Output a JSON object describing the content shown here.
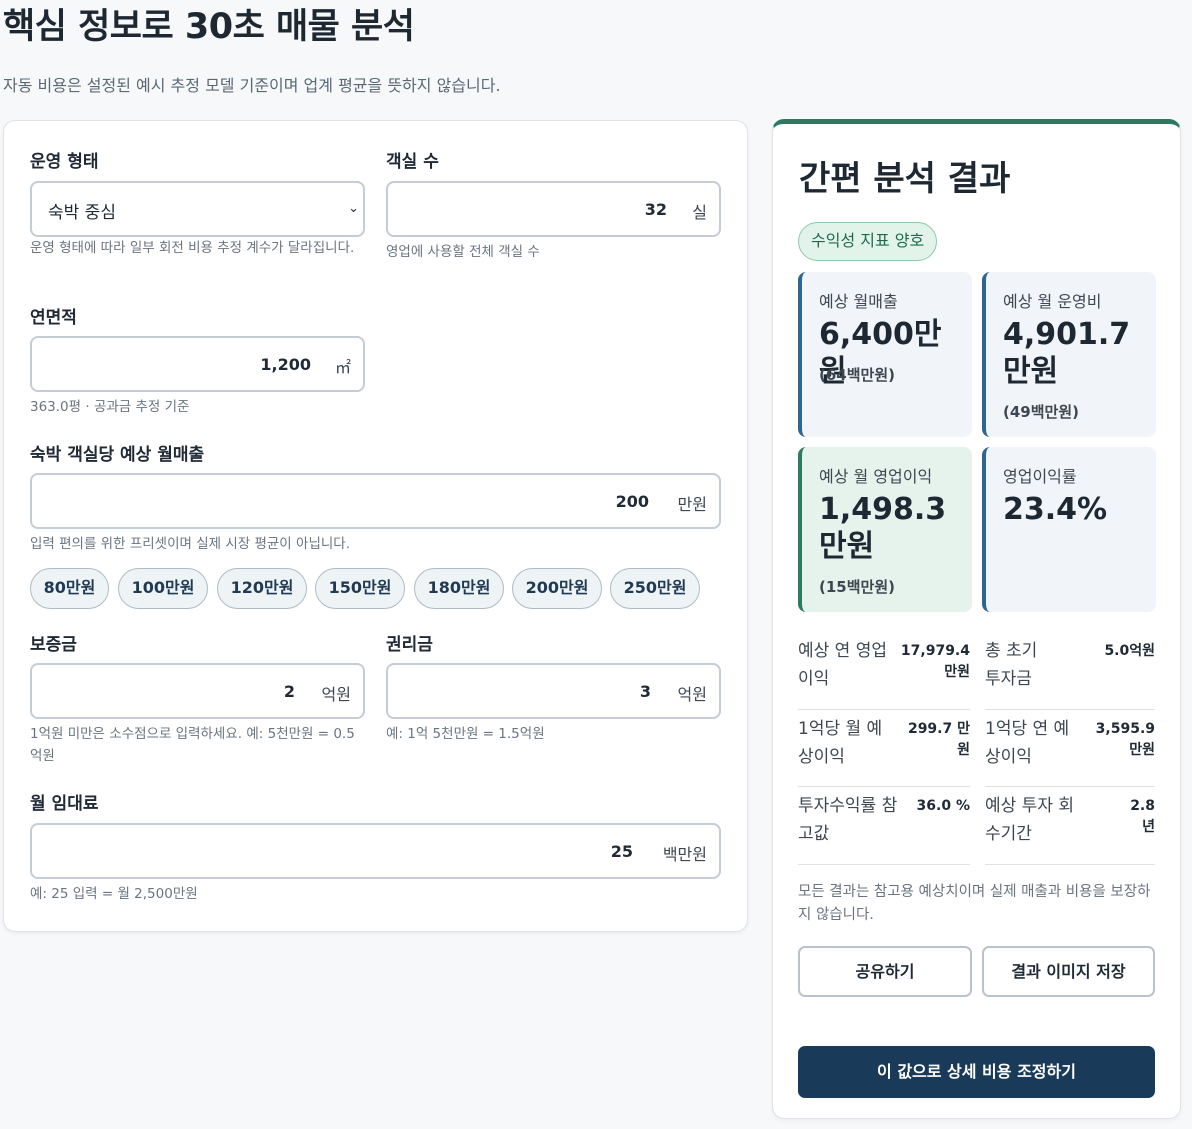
{
  "header": {
    "title": "핵심 정보로 30초 매물 분석",
    "subtitle": "자동 비용은 설정된 예시 추정 모델 기준이며 업계 평균을 뜻하지 않습니다."
  },
  "form": {
    "operation_type": {
      "label": "운영 형태",
      "value": "숙박 중심",
      "hint": "운영 형태에 따라 일부 회전 비용 추정 계수가 달라집니다."
    },
    "rooms": {
      "label": "객실 수",
      "value": "32",
      "unit": "실",
      "hint": "영업에 사용할 전체 객실 수"
    },
    "floor_area": {
      "label": "연면적",
      "value": "1,200",
      "unit": "㎡",
      "hint": "363.0평 · 공과금 추정 기준"
    },
    "revenue_per_room": {
      "label": "숙박 객실당 예상 월매출",
      "value": "200",
      "unit": "만원",
      "hint": "입력 편의를 위한 프리셋이며 실제 시장 평균이 아닙니다.",
      "presets": [
        "80만원",
        "100만원",
        "120만원",
        "150만원",
        "180만원",
        "200만원",
        "250만원"
      ]
    },
    "deposit": {
      "label": "보증금",
      "value": "2",
      "unit": "억원",
      "hint": "1억원 미만은 소수점으로 입력하세요. 예: 5천만원 = 0.5억원"
    },
    "premium": {
      "label": "권리금",
      "value": "3",
      "unit": "억원",
      "hint": "예: 1억 5천만원 = 1.5억원"
    },
    "monthly_rent": {
      "label": "월 임대료",
      "value": "25",
      "unit": "백만원",
      "hint": "예: 25 입력 = 월 2,500만원"
    }
  },
  "result": {
    "title": "간편 분석 결과",
    "badge": "수익성 지표 양호",
    "metrics": [
      {
        "label": "예상 월매출",
        "value": "6,400만원",
        "sub": "(64백만원)"
      },
      {
        "label": "예상 월 운영비",
        "value": "4,901.7만원",
        "sub": "(49백만원)"
      },
      {
        "label": "예상 월 영업이익",
        "value": "1,498.3만원",
        "sub": "(15백만원)"
      },
      {
        "label": "영업이익률",
        "value": "23.4%",
        "sub": ""
      }
    ],
    "stats": [
      {
        "label": "예상 연 영업이익",
        "value": "17,979.4 만원"
      },
      {
        "label": "총 초기 투자금",
        "value": "5.0억원"
      },
      {
        "label": "1억당 월 예상이익",
        "value": "299.7 만원"
      },
      {
        "label": "1억당 연 예상이익",
        "value": "3,595.9 만원"
      },
      {
        "label": "투자수익률 참고값",
        "value": "36.0 %"
      },
      {
        "label": "예상 투자 회수기간",
        "value": "2.8 년"
      }
    ],
    "disclaimer": "모든 결과는 참고용 예상치이며 실제 매출과 비용을 보장하지 않습니다.",
    "share_label": "공유하기",
    "save_image_label": "결과 이미지 저장",
    "adjust_label": "이 값으로 상세 비용 조정하기"
  },
  "colors": {
    "accent_green": "#2d7a60",
    "accent_blue": "#2f6591",
    "primary_button": "#193a58"
  }
}
